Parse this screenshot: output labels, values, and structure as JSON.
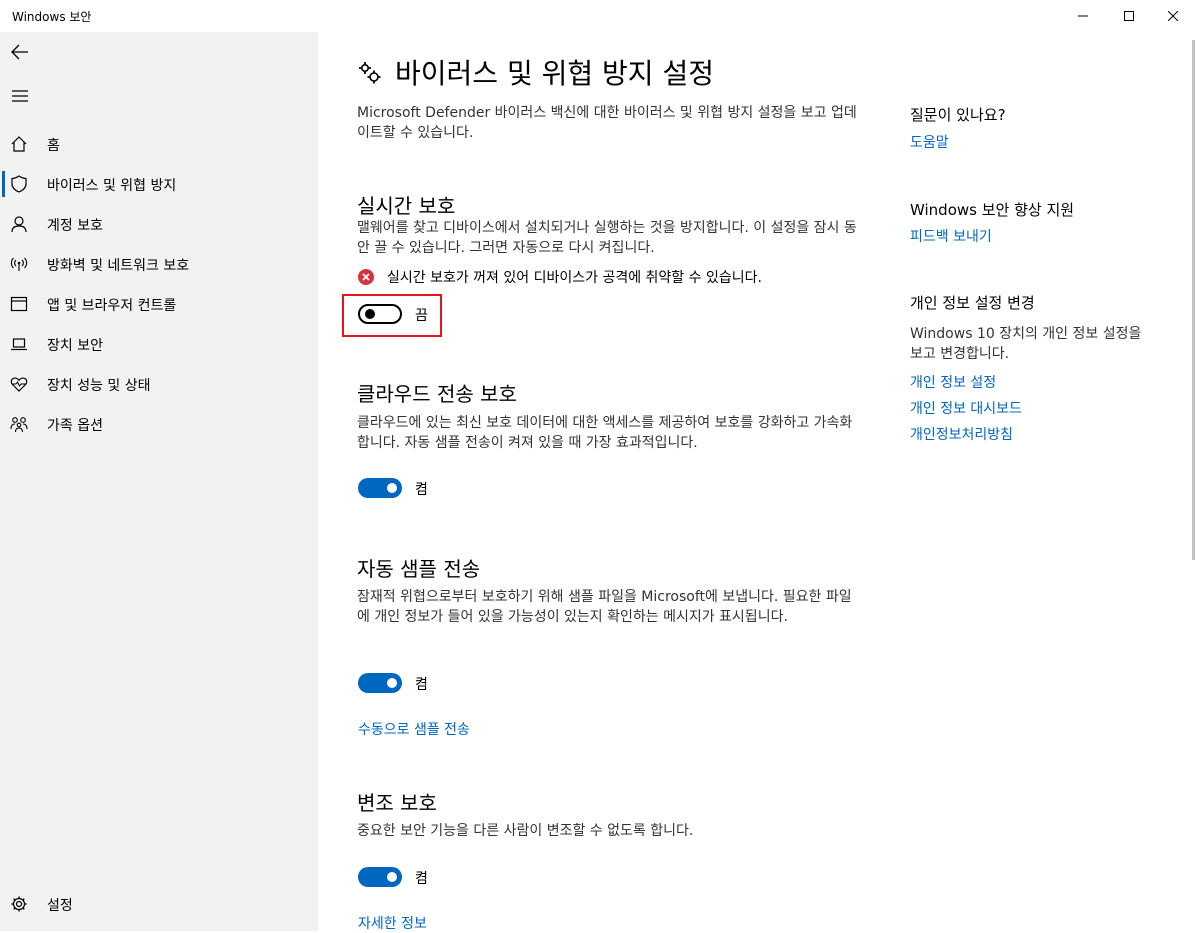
{
  "window": {
    "title": "Windows 보안"
  },
  "sidebar": {
    "items": [
      {
        "label": "홈",
        "icon": "home-icon"
      },
      {
        "label": "바이러스 및 위협 방지",
        "icon": "shield-icon",
        "active": true
      },
      {
        "label": "계정 보호",
        "icon": "person-icon"
      },
      {
        "label": "방화벽 및 네트워크 보호",
        "icon": "wifi-antenna-icon"
      },
      {
        "label": "앱 및 브라우저 컨트롤",
        "icon": "app-window-icon"
      },
      {
        "label": "장치 보안",
        "icon": "laptop-icon"
      },
      {
        "label": "장치 성능 및 상태",
        "icon": "heart-pulse-icon"
      },
      {
        "label": "가족 옵션",
        "icon": "family-icon"
      }
    ],
    "settings_label": "설정"
  },
  "main": {
    "title": "바이러스 및 위협 방지 설정",
    "intro": "Microsoft Defender 바이러스 백신에 대한 바이러스 및 위협 방지 설정을 보고 업데이트할 수 있습니다.",
    "realtime": {
      "heading": "실시간 보호",
      "desc": "맬웨어를 찾고 디바이스에서 설치되거나 실행하는 것을 방지합니다. 이 설정을 잠시 동안 끌 수 있습니다. 그러면 자동으로 다시 켜집니다.",
      "warning": "실시간 보호가 꺼져 있어 디바이스가 공격에 취약할 수 있습니다.",
      "toggle_state": "off",
      "toggle_label": "끔"
    },
    "cloud": {
      "heading": "클라우드 전송 보호",
      "desc": "클라우드에 있는 최신 보호 데이터에 대한 액세스를 제공하여 보호를 강화하고 가속화합니다. 자동 샘플 전송이 켜져 있을 때 가장 효과적입니다.",
      "toggle_state": "on",
      "toggle_label": "켬"
    },
    "sample": {
      "heading": "자동 샘플 전송",
      "desc": "잠재적 위협으로부터 보호하기 위해 샘플 파일을 Microsoft에 보냅니다. 필요한 파일에 개인 정보가 들어 있을 가능성이 있는지 확인하는 메시지가 표시됩니다.",
      "toggle_state": "on",
      "toggle_label": "켬",
      "link": "수동으로 샘플 전송"
    },
    "tamper": {
      "heading": "변조 보호",
      "desc": "중요한 보안 기능을 다른 사람이 변조할 수 없도록 합니다.",
      "toggle_state": "on",
      "toggle_label": "켬",
      "link": "자세한 정보"
    }
  },
  "right": {
    "help_heading": "질문이 있나요?",
    "help_link": "도움말",
    "improve_heading": "Windows 보안 향상 지원",
    "improve_link": "피드백 보내기",
    "privacy_heading": "개인 정보 설정 변경",
    "privacy_desc": "Windows 10 장치의 개인 정보 설정을 보고 변경합니다.",
    "privacy_links": [
      "개인 정보 설정",
      "개인 정보 대시보드",
      "개인정보처리방침"
    ]
  },
  "colors": {
    "accent": "#0067c0",
    "sidebar_bg": "#f2f2f2",
    "warning": "#d6333c",
    "highlight": "#e3141b"
  }
}
